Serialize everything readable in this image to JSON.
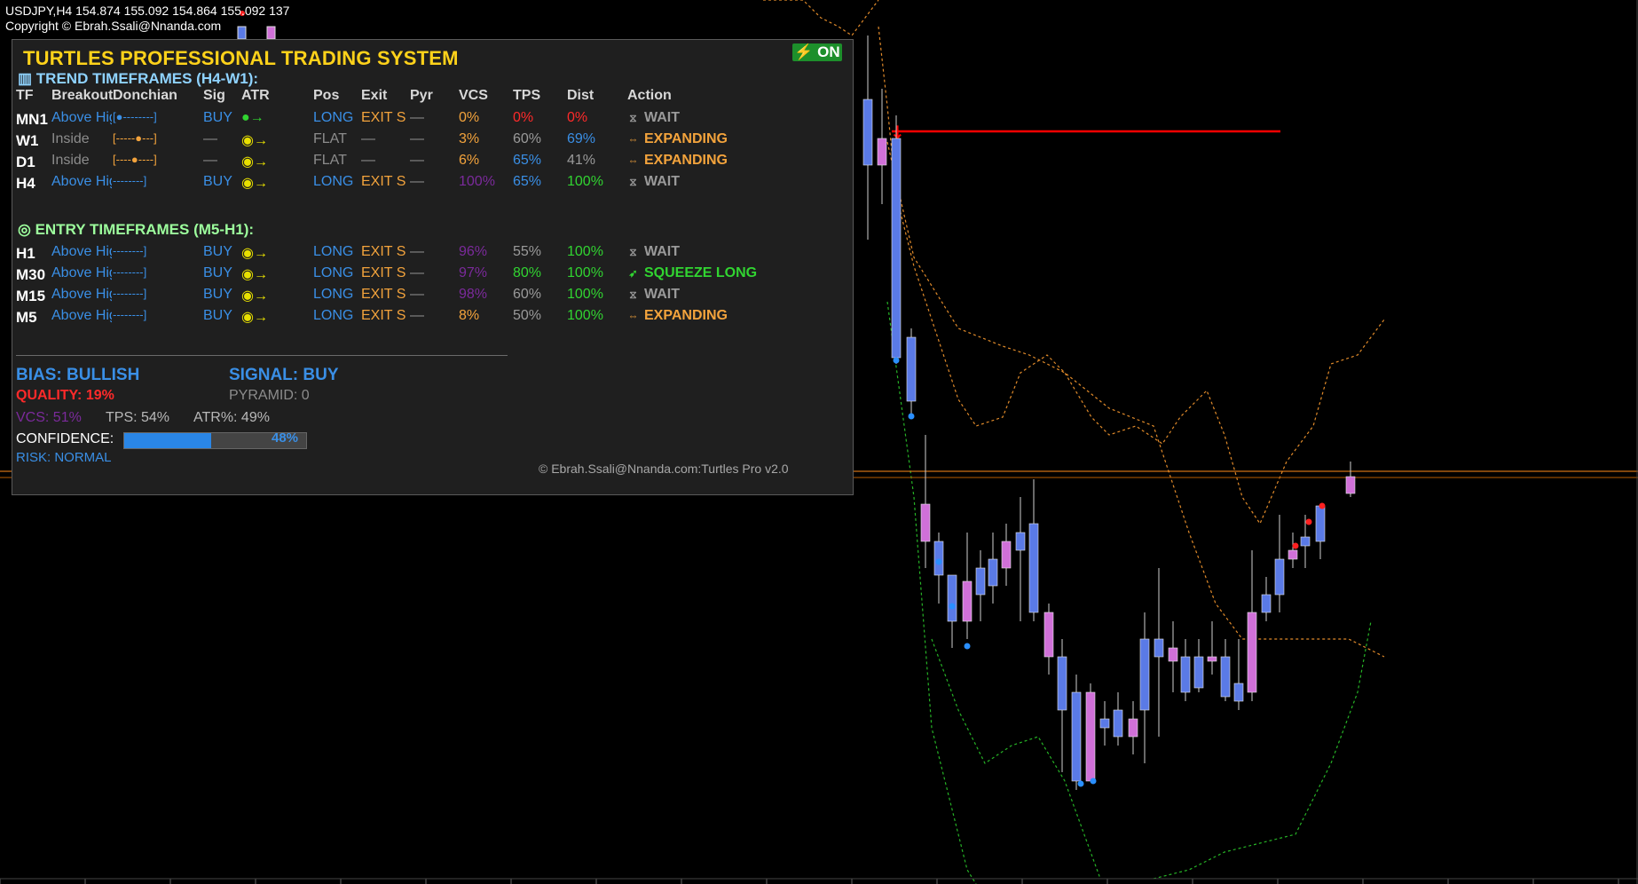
{
  "chart_header": {
    "line1": "USDJPY,H4  154.874 155.092 154.864 155.092  137",
    "line2": "Copyright © Ebrah.Ssali@Nnanda.com"
  },
  "panel": {
    "title": "TURTLES PROFESSIONAL TRADING SYSTEM",
    "status_badge": "⚡ ON",
    "trend_section_title": "TREND TIMEFRAMES (H4-W1):",
    "entry_section_title": "ENTRY TIMEFRAMES (M5-H1):",
    "headers": {
      "tf": "TF",
      "breakout": "Breakout",
      "donchian": "Donchian",
      "sig": "Sig",
      "atr": "ATR",
      "pos": "Pos",
      "exit": "Exit",
      "pyr": "Pyr",
      "vcs": "VCS",
      "tps": "TPS",
      "dist": "Dist",
      "action": "Action"
    },
    "trend_rows": [
      {
        "tf": "MN1",
        "breakout": "Above Hig",
        "donchian": "[●--------]",
        "sig": "BUY",
        "atr": "●→",
        "pos": "LONG",
        "exit": "EXIT S",
        "pyr": "—",
        "vcs": "0%",
        "tps": "0%",
        "dist": "0%",
        "action": "WAIT"
      },
      {
        "tf": "W1",
        "breakout": "Inside",
        "donchian": "[-----●---]",
        "sig": "—",
        "atr": "◉→",
        "pos": "FLAT",
        "exit": "—",
        "pyr": "—",
        "vcs": "3%",
        "tps": "60%",
        "dist": "69%",
        "action": "EXPANDING"
      },
      {
        "tf": "D1",
        "breakout": "Inside",
        "donchian": "[----●----]",
        "sig": "—",
        "atr": "◉→",
        "pos": "FLAT",
        "exit": "—",
        "pyr": "—",
        "vcs": "6%",
        "tps": "65%",
        "dist": "41%",
        "action": "EXPANDING"
      },
      {
        "tf": "H4",
        "breakout": "Above High",
        "donchian": "--------]",
        "sig": "BUY",
        "atr": "◉→",
        "pos": "LONG",
        "exit": "EXIT S",
        "pyr": "—",
        "vcs": "100%",
        "tps": "65%",
        "dist": "100%",
        "action": "WAIT"
      }
    ],
    "entry_rows": [
      {
        "tf": "H1",
        "breakout": "Above High",
        "donchian": "--------]",
        "sig": "BUY",
        "atr": "◉→",
        "pos": "LONG",
        "exit": "EXIT S",
        "pyr": "—",
        "vcs": "96%",
        "tps": "55%",
        "dist": "100%",
        "action": "WAIT"
      },
      {
        "tf": "M30",
        "breakout": "Above High",
        "donchian": "--------]",
        "sig": "BUY",
        "atr": "◉→",
        "pos": "LONG",
        "exit": "EXIT S",
        "pyr": "—",
        "vcs": "97%",
        "tps": "80%",
        "dist": "100%",
        "action": "SQUEEZE LONG"
      },
      {
        "tf": "M15",
        "breakout": "Above High",
        "donchian": "--------]",
        "sig": "BUY",
        "atr": "◉→",
        "pos": "LONG",
        "exit": "EXIT S",
        "pyr": "—",
        "vcs": "98%",
        "tps": "60%",
        "dist": "100%",
        "action": "WAIT"
      },
      {
        "tf": "M5",
        "breakout": "Above High",
        "donchian": "--------]",
        "sig": "BUY",
        "atr": "◉→",
        "pos": "LONG",
        "exit": "EXIT S",
        "pyr": "—",
        "vcs": "8%",
        "tps": "50%",
        "dist": "100%",
        "action": "EXPANDING"
      }
    ],
    "summary": {
      "bias": "BIAS: BULLISH",
      "signal": "SIGNAL: BUY",
      "quality_label": "QUALITY:",
      "quality_value": "19%",
      "pyramid": "PYRAMID: 0",
      "vcs": "VCS: 51%",
      "tps": "TPS: 54%",
      "atr": "ATR%: 49%",
      "confidence_label": "CONFIDENCE:",
      "confidence_value": "48%",
      "confidence_fraction": 0.48,
      "risk": "RISK: NORMAL",
      "copyright": "© Ebrah.Ssali@Nnanda.com:Turtles Pro v2.0"
    }
  },
  "colors": {
    "bull_candle": "#5a7ae6",
    "bear_candle": "#d070d8",
    "signal_line": "#ff0000",
    "level_line": "#ff8c1a",
    "upper_band": "#e08a2a",
    "lower_band": "#26b326"
  }
}
